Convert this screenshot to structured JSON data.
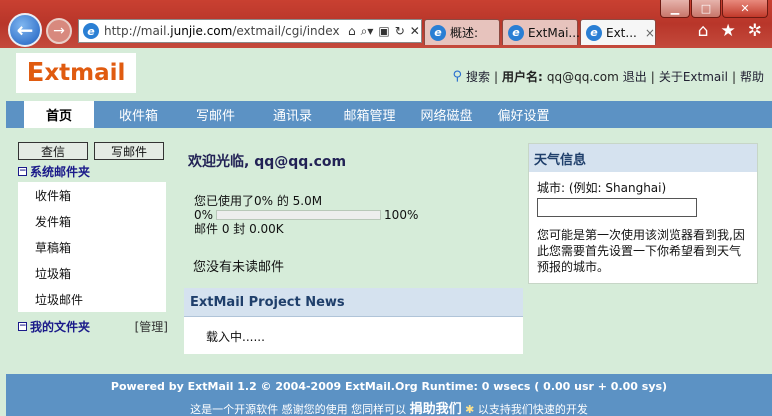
{
  "browser": {
    "url_prefix": "http://mail.",
    "url_domain": "junjie.com",
    "url_suffix": "/extmail/cgi/index",
    "tabs": [
      {
        "label": "概述:"
      },
      {
        "label": "ExtMai..."
      },
      {
        "label": "Ext..."
      }
    ],
    "tab_close": "×"
  },
  "header": {
    "logo_e": "E",
    "logo_rest": "xtmail",
    "search_label": "搜索",
    "separator": "|",
    "username_label": "用户名:",
    "username": "qq@qq.com",
    "logout": "退出",
    "about": "关于Extmail",
    "help": "帮助"
  },
  "menu": [
    {
      "label": "首页"
    },
    {
      "label": "收件箱"
    },
    {
      "label": "写邮件"
    },
    {
      "label": "通讯录"
    },
    {
      "label": "邮箱管理"
    },
    {
      "label": "网络磁盘"
    },
    {
      "label": "偏好设置"
    }
  ],
  "sidebar": {
    "check_button": "查信",
    "compose_button": "写邮件",
    "system_folders": "系统邮件夹",
    "folders": [
      {
        "label": "收件箱"
      },
      {
        "label": "发件箱"
      },
      {
        "label": "草稿箱"
      },
      {
        "label": "垃圾箱"
      },
      {
        "label": "垃圾邮件"
      }
    ],
    "my_folders": "我的文件夹",
    "manage": "[管理]"
  },
  "main": {
    "welcome": "欢迎光临, qq@qq.com",
    "usage_text": "您已使用了0% 的 5.0M",
    "usage_fraction": 0,
    "usage_min": "0%",
    "usage_max": "100%",
    "mail_count": "邮件 0 封 0.00K",
    "unread": "您没有未读邮件",
    "news_title": "ExtMail Project News",
    "news_loading": "载入中......"
  },
  "weather": {
    "title": "天气信息",
    "city_label": "城市: (例如: Shanghai)",
    "city_value": "",
    "note": "您可能是第一次使用该浏览器看到我,因此您需要首先设置一下你希望看到天气预报的城市。"
  },
  "footer": {
    "line1": "Powered by ExtMail 1.2 © 2004-2009 ExtMail.Org Runtime: 0 wsecs ( 0.00 usr + 0.00 sys)",
    "line2_pre": "这是一个开源软件 感谢您的使用 您同样可以",
    "donate": "捐助我们",
    "line2_post": "以支持我们快速的开发"
  }
}
